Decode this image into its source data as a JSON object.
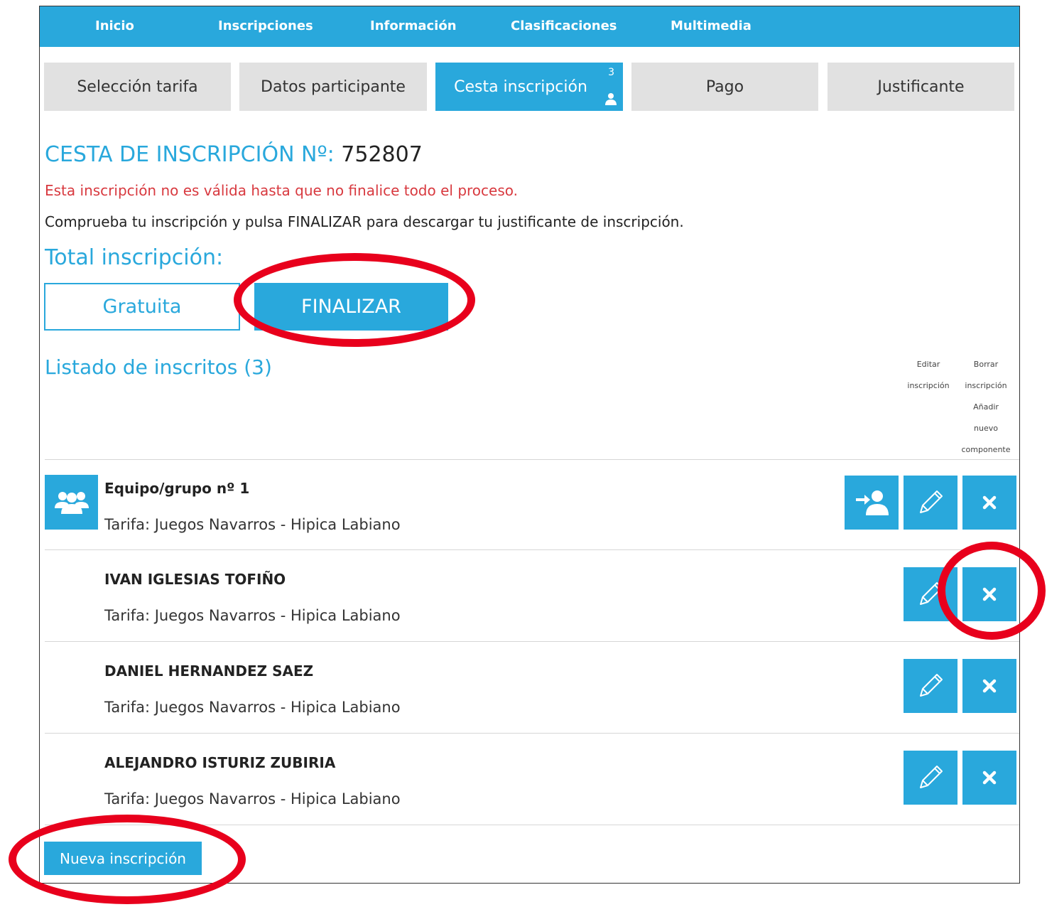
{
  "nav": {
    "items": [
      "Inicio",
      "Inscripciones",
      "Información",
      "Clasificaciones",
      "Multimedia"
    ]
  },
  "steps": {
    "s1": "Selección tarifa",
    "s2": "Datos participante",
    "s3": "Cesta inscripción",
    "s3_count": "3",
    "s4": "Pago",
    "s5": "Justificante"
  },
  "cesta": {
    "title_prefix": "CESTA DE INSCRIPCIÓN Nº:",
    "number": "752807",
    "warning": "Esta inscripción no es válida hasta que no finalice todo el proceso.",
    "info": "Comprueba tu inscripción y pulsa FINALIZAR para descargar tu justificante de inscripción.",
    "total_label": "Total inscripción:",
    "total_value": "Gratuita",
    "finalizar": "FINALIZAR"
  },
  "listado": {
    "title": "Listado de inscritos (3)",
    "col_editar_1": "Editar",
    "col_editar_2": "inscripción",
    "col_borrar_1": "Borrar",
    "col_borrar_2": "inscripción",
    "col_add_1": "Añadir",
    "col_add_2": "nuevo",
    "col_add_3": "componente",
    "rows": [
      {
        "name": "Equipo/grupo nº 1",
        "tarifa": "Tarifa: Juegos Navarros - Hipica Labiano"
      },
      {
        "name": "IVAN IGLESIAS TOFIÑO",
        "tarifa": "Tarifa: Juegos Navarros - Hipica Labiano"
      },
      {
        "name": "DANIEL HERNANDEZ SAEZ",
        "tarifa": "Tarifa: Juegos Navarros - Hipica Labiano"
      },
      {
        "name": "ALEJANDRO ISTURIZ ZUBIRIA",
        "tarifa": "Tarifa: Juegos Navarros - Hipica Labiano"
      }
    ]
  },
  "nueva_inscripcion": "Nueva inscripción",
  "colors": {
    "accent": "#29a8dc",
    "warning": "#d8393f",
    "annotation": "#e8001c"
  }
}
